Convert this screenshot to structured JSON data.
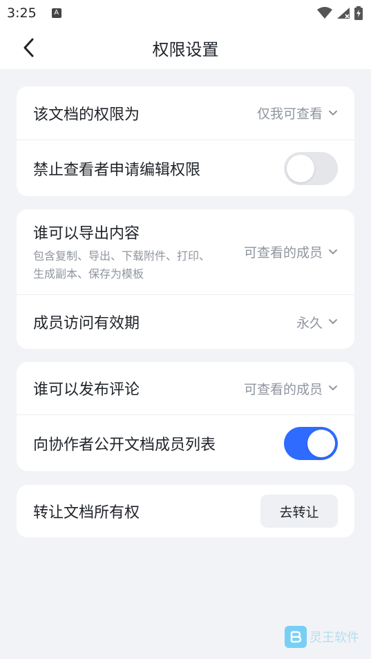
{
  "status_bar": {
    "time": "3:25",
    "notif_icon": "A"
  },
  "header": {
    "title": "权限设置"
  },
  "card1": {
    "row1": {
      "label": "该文档的权限为",
      "value": "仅我可查看"
    },
    "row2": {
      "label": "禁止查看者申请编辑权限",
      "toggle": false
    }
  },
  "card2": {
    "row1": {
      "label": "谁可以导出内容",
      "description": "包含复制、导出、下载附件、打印、生成副本、保存为模板",
      "value": "可查看的成员"
    },
    "row2": {
      "label": "成员访问有效期",
      "value": "永久"
    }
  },
  "card3": {
    "row1": {
      "label": "谁可以发布评论",
      "value": "可查看的成员"
    },
    "row2": {
      "label": "向协作者公开文档成员列表",
      "toggle": true
    }
  },
  "card4": {
    "row1": {
      "label": "转让文档所有权",
      "button": "去转让"
    }
  },
  "watermark": {
    "text": "灵王软件"
  },
  "colors": {
    "accent": "#2f6bff",
    "background": "#f2f3f6",
    "secondary_text": "#8f959e"
  }
}
